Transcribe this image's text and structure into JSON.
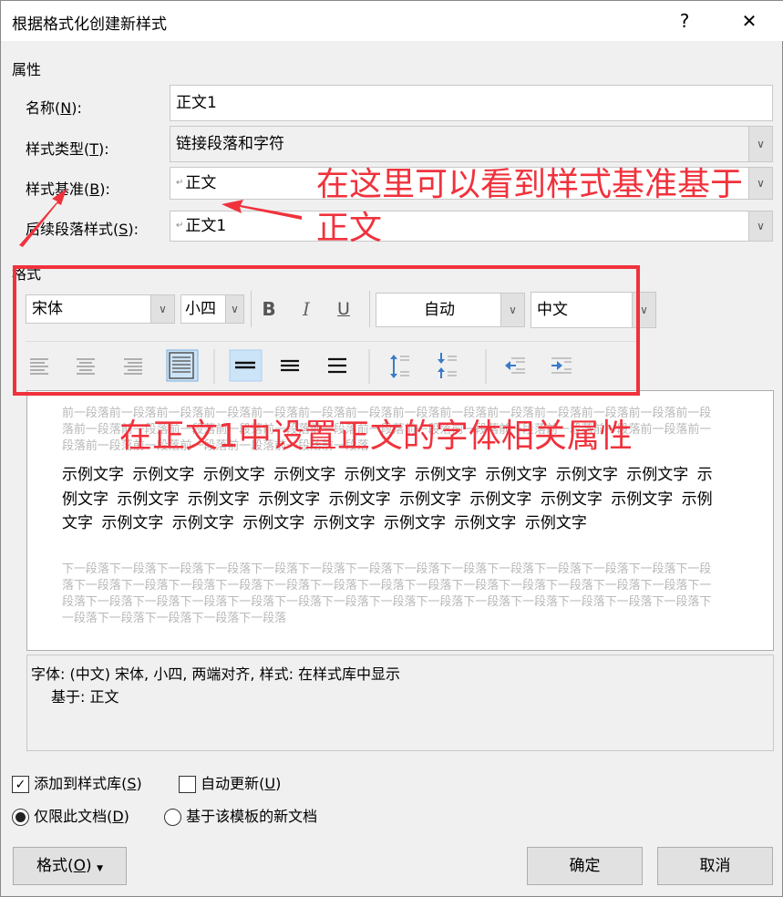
{
  "window": {
    "title": "根据格式化创建新样式",
    "help": "?",
    "close": "✕"
  },
  "properties": {
    "section": "属性",
    "name": {
      "pre": "名称(",
      "key": "N",
      "post": "):",
      "value": "正文1"
    },
    "type": {
      "pre": "样式类型(",
      "key": "T",
      "post": "):",
      "value": "链接段落和字符"
    },
    "base": {
      "pre": "样式基准(",
      "key": "B",
      "post": "):",
      "value": "正文"
    },
    "next": {
      "pre": "后续段落样式(",
      "key": "S",
      "post": "):",
      "value": "正文1"
    }
  },
  "format": {
    "section": "格式",
    "font": "宋体",
    "size": "小四",
    "bold": "B",
    "italic": "I",
    "underline": "U",
    "color": "自动",
    "script": "中文"
  },
  "preview": {
    "prev": "前一段落前一段落前一段落前一段落前一段落前一段落前一段落前一段落前一段落前一段落前一段落前一段落前一段落前一段落前一段落前一段落前一段落前一段落前一段落前一段落前一段落前一段落前一段落前一段落前一段落前一段落前一段落前一段落前一段落前一段落前一段落前一段落前一段落前一段落",
    "sample": "示例文字 示例文字 示例文字 示例文字 示例文字 示例文字 示例文字 示例文字 示例文字 示例文字 示例文字 示例文字 示例文字 示例文字 示例文字 示例文字 示例文字 示例文字 示例文字 示例文字 示例文字 示例文字 示例文字 示例文字 示例文字 示例文字",
    "next": "下一段落下一段落下一段落下一段落下一段落下一段落下一段落下一段落下一段落下一段落下一段落下一段落下一段落下一段落下一段落下一段落下一段落下一段落下一段落下一段落下一段落下一段落下一段落下一段落下一段落下一段落下一段落下一段落下一段落下一段落下一段落下一段落下一段落下一段落下一段落下一段落下一段落下一段落下一段落下一段落下一段落下一段落下一段落下一段落下一段落下一段落"
  },
  "description": {
    "line1": "字体: (中文) 宋体, 小四, 两端对齐, 样式: 在样式库中显示",
    "line2": "基于: 正文"
  },
  "options": {
    "add_gallery": {
      "pre": "添加到样式库(",
      "key": "S",
      "post": ")",
      "checked": true
    },
    "auto_update": {
      "pre": "自动更新(",
      "key": "U",
      "post": ")",
      "checked": false
    },
    "this_doc": {
      "pre": "仅限此文档(",
      "key": "D",
      "post": ")",
      "selected": true
    },
    "new_docs": {
      "label": "基于该模板的新文档",
      "selected": false
    }
  },
  "buttons": {
    "format": {
      "pre": "格式(",
      "key": "O",
      "post": ")"
    },
    "ok": "确定",
    "cancel": "取消"
  },
  "annotations": {
    "base_note_line1": "在这里可以看到样式基准基于",
    "base_note_line2": "正文",
    "format_note": "在正文1中设置正文的字体相关属性",
    "color": "#f0323c"
  }
}
